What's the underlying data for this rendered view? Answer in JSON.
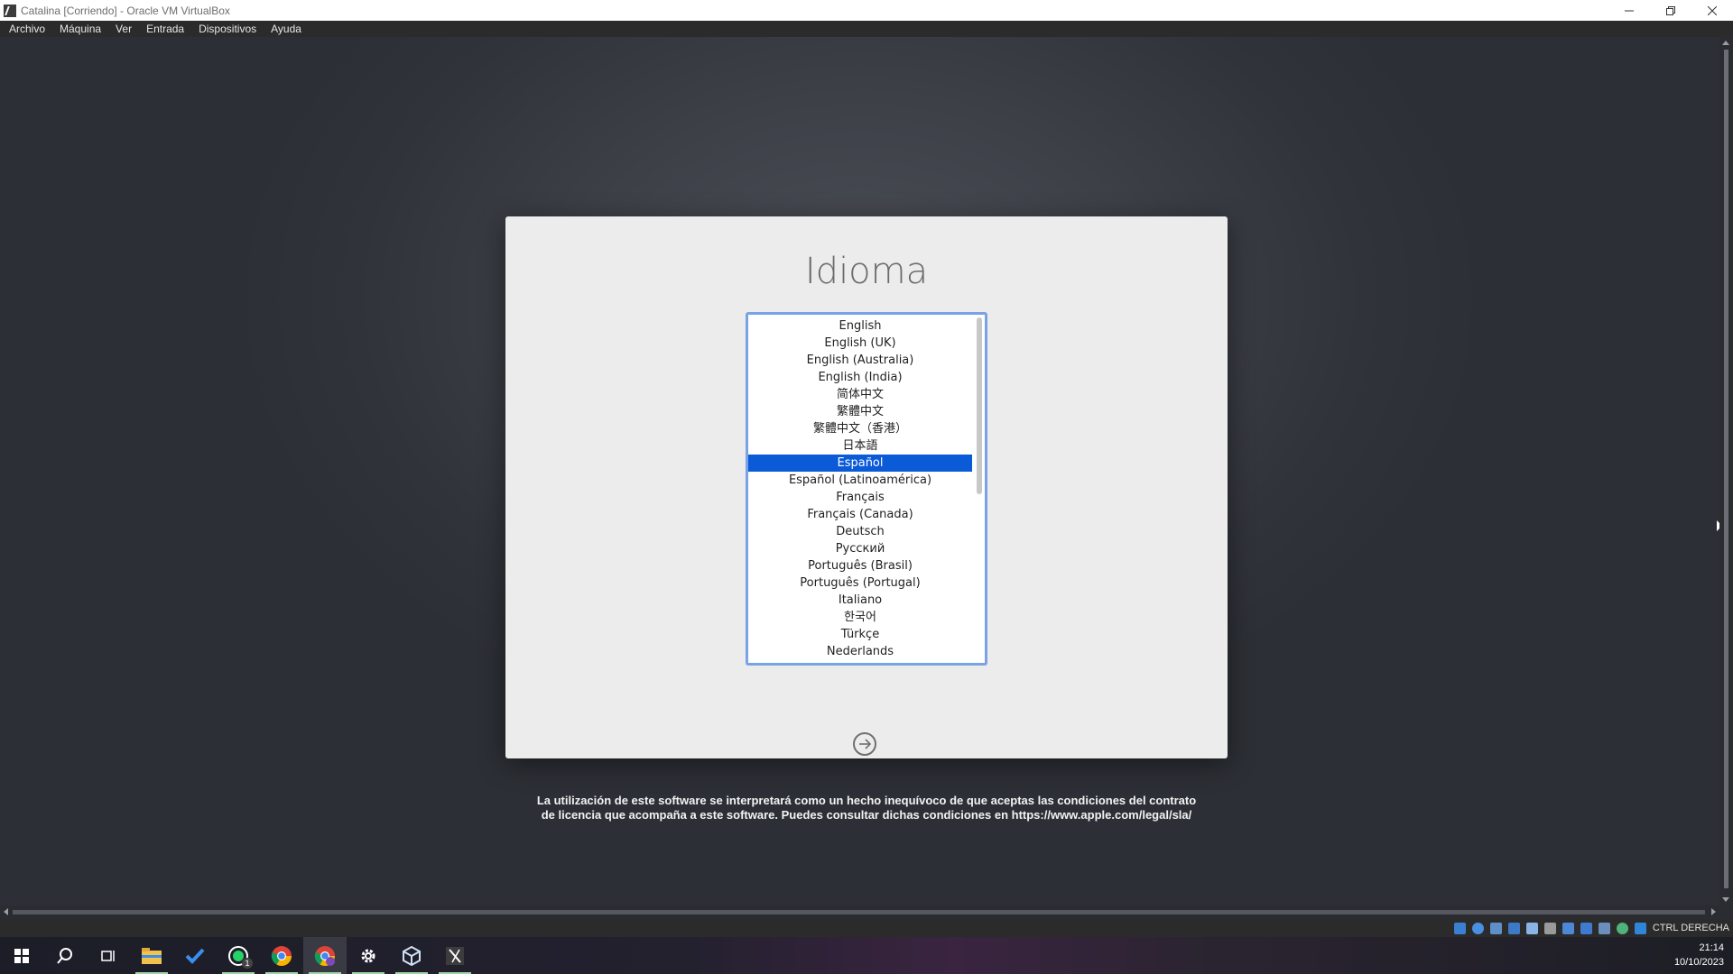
{
  "window": {
    "title": "Catalina [Corriendo] - Oracle VM VirtualBox",
    "controls": [
      "minimize",
      "restore",
      "close"
    ]
  },
  "menubar": {
    "items": [
      "Archivo",
      "Máquina",
      "Ver",
      "Entrada",
      "Dispositivos",
      "Ayuda"
    ]
  },
  "installer": {
    "title": "Idioma",
    "languages": [
      "English",
      "English (UK)",
      "English (Australia)",
      "English (India)",
      "简体中文",
      "繁體中文",
      "繁體中文（香港）",
      "日本語",
      "Español",
      "Español (Latinoamérica)",
      "Français",
      "Français (Canada)",
      "Deutsch",
      "Русский",
      "Português (Brasil)",
      "Português (Portugal)",
      "Italiano",
      "한국어",
      "Türkçe",
      "Nederlands"
    ],
    "selected": "Español",
    "next_icon": "arrow-right-circle-icon",
    "license_line1": "La utilización de este software se interpretará como un hecho inequívoco de que aceptas las condiciones del contrato",
    "license_line2": "de licencia que acompaña a este software. Puedes consultar dichas condiciones en https://www.apple.com/legal/sla/"
  },
  "statusbar": {
    "icons": [
      "hard-disk-icon",
      "optical-drive-icon",
      "audio-icon",
      "network-icon",
      "usb-icon",
      "shared-folders-icon",
      "display-icon",
      "recording-icon",
      "cpu-icon",
      "mouse-integration-icon",
      "keyboard-icon"
    ],
    "host_key": "CTRL DERECHA"
  },
  "taskbar": {
    "apps": [
      "windows-start-icon",
      "search-icon",
      "task-view-icon",
      "file-explorer-icon",
      "todo-icon",
      "whatsapp-icon",
      "chrome-icon",
      "chrome-profile-icon",
      "settings-icon",
      "virtualbox-icon",
      "vm-window-icon"
    ],
    "whatsapp_badge": "1",
    "time": "21:14",
    "date": "10/10/2023"
  },
  "colors": {
    "selection": "#0b5ad8",
    "focus_ring": "#7aa2e6"
  }
}
